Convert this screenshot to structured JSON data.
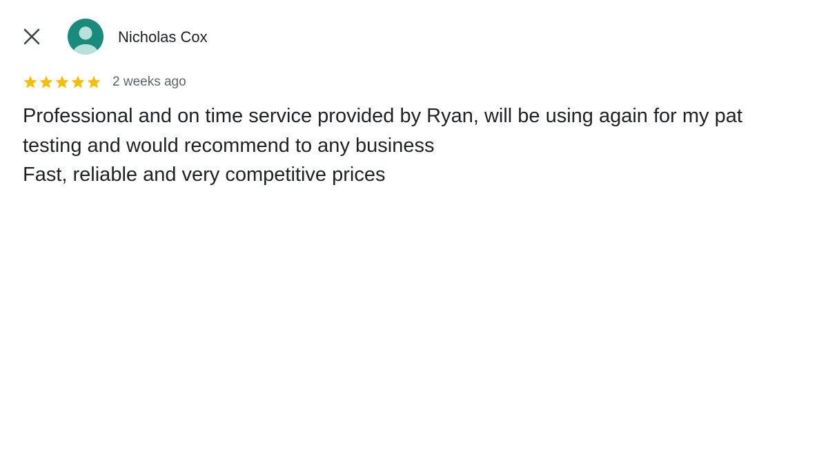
{
  "review": {
    "reviewer_name": "Nicholas Cox",
    "rating": 5,
    "rating_max": 5,
    "time": "2 weeks ago",
    "text_lines": [
      "Professional and on time service provided by Ryan, will be using again for my pat",
      "testing and would recommend to any business",
      "Fast, reliable and very competitive prices"
    ]
  },
  "icons": {
    "close": "close-icon",
    "avatar": "person-icon",
    "star": "star-icon"
  },
  "colors": {
    "avatar_bg": "#1a8a7d",
    "avatar_fg": "#b9e0da",
    "star": "#fbbc04",
    "text": "#202124",
    "muted": "#5f6368"
  }
}
